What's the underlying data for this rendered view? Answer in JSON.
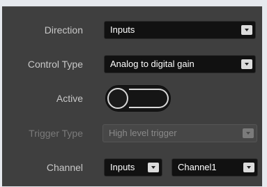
{
  "form": {
    "direction": {
      "label": "Direction",
      "value": "Inputs"
    },
    "control_type": {
      "label": "Control Type",
      "value": "Analog to digital gain"
    },
    "active": {
      "label": "Active",
      "on": false
    },
    "trigger_type": {
      "label": "Trigger Type",
      "value": "High level trigger",
      "disabled": true
    },
    "channel": {
      "label": "Channel",
      "source_value": "Inputs",
      "channel_value": "Channel1"
    }
  },
  "colors": {
    "panel_bg": "#3f3f3f",
    "select_bg": "#111111",
    "label_text": "#c8c8c8",
    "disabled_text": "#7a7a7a"
  },
  "icons": {
    "dropdown": "chevron-down-icon"
  }
}
